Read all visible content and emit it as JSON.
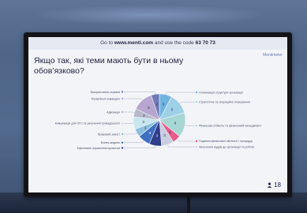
{
  "presentation": {
    "join_prefix": "Go to ",
    "join_url": "www.menti.com",
    "join_middle": " and use the code ",
    "join_code": "63 70 73",
    "brand": "Mentimeter",
    "question": "Якщо так, які теми мають бути в ньому обов’язково?",
    "participants": "18"
  },
  "chart_data": {
    "type": "pie",
    "slices": [
      {
        "label": "Оптимізація структури організації",
        "value": 3,
        "color": "#6fb3e0"
      },
      {
        "label": "Стратегічне та операційне планування",
        "value": 5,
        "color": "#9ed0e8"
      },
      {
        "label": "Фінансова стійкість та фінансовий менеджмент",
        "value": 6,
        "color": "#a7d7d4"
      },
      {
        "label": "Подання фінансової звітності / процедур",
        "value": 2,
        "color": "#e85b8b"
      },
      {
        "label": "Залучення кадрів до організації та роботи",
        "value": 3,
        "color": "#c9cfe0"
      },
      {
        "label": "Ефективне управління проєктом",
        "value": 3,
        "color": "#2f3d8a"
      },
      {
        "label": "Бізнес-модель",
        "value": 3,
        "color": "#3f6fbf"
      },
      {
        "label": "Правовий захист",
        "value": 2,
        "color": "#8cbfdc"
      },
      {
        "label": "Комунікація для ОГС та залучення громадськості",
        "value": 3,
        "color": "#c8e6ee"
      },
      {
        "label": "Адвокація",
        "value": 2,
        "color": "#b8b9cc"
      },
      {
        "label": "Управління командою",
        "value": 5,
        "color": "#b7a6cf"
      },
      {
        "label": "Використання сервісів",
        "value": 2,
        "color": "#6e7bb8"
      }
    ]
  }
}
